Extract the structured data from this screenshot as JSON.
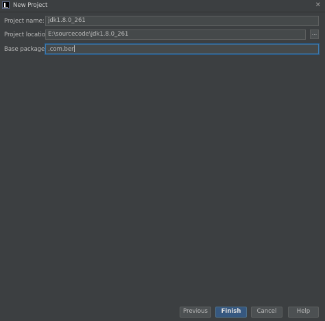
{
  "window": {
    "title": "New Project",
    "close_glyph": "✕",
    "app_icon": "intellij-idea-icon"
  },
  "form": {
    "project_name": {
      "label": "Project name:",
      "value": "jdk1.8.0_261"
    },
    "project_location": {
      "label": "Project location:",
      "value": "E:\\sourcecode\\jdk1.8.0_261",
      "browse_label": "..."
    },
    "base_package": {
      "label": "Base package:",
      "value": ".com.ber"
    }
  },
  "buttons": {
    "previous": "Previous",
    "finish": "Finish",
    "cancel": "Cancel",
    "help": "Help"
  },
  "colors": {
    "background": "#3c3f41",
    "field_background": "#45494a",
    "focus_border": "#3d7bb0",
    "primary_button": "#365880"
  }
}
